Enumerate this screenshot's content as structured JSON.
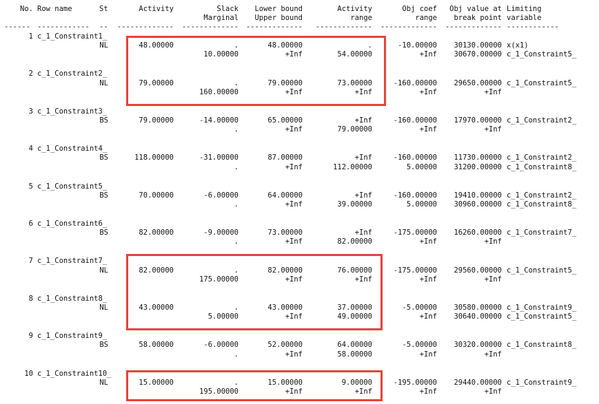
{
  "headers": {
    "no": "No.",
    "row_name": "Row name",
    "st": "St",
    "activity": "Activity",
    "slack_1": "Slack",
    "slack_2": "Marginal",
    "bound_1": "Lower bound",
    "bound_2": "Upper bound",
    "range_1": "Activity",
    "range_2": "range",
    "objcoef_1": "Obj coef",
    "objcoef_2": "range",
    "objval_1": "Obj value at",
    "objval_2": "break point",
    "limiting_1": "Limiting",
    "limiting_2": "variable"
  },
  "separator": {
    "no": "------",
    "row_name": "------------",
    "st": "--",
    "activity": "-------------",
    "slack": "-------------",
    "bound": "-------------",
    "range": "-------------",
    "objcoef": "-------------",
    "objval": "-------------",
    "limiting": "------------"
  },
  "rows": [
    {
      "no": "1",
      "name": "c_1_Constraint1_",
      "st": "NL",
      "activity": "48.00000",
      "slack": ".",
      "marginal": "10.00000",
      "lower": "48.00000",
      "upper": "+Inf",
      "range_lo": ".",
      "range_hi": "54.00000",
      "coef_lo": "-10.00000",
      "coef_hi": "+Inf",
      "objval_lo": "30130.00000",
      "objval_hi": "30670.00000",
      "limit_lo": "x(x1)",
      "limit_hi": "c_1_Constraint5_"
    },
    {
      "no": "2",
      "name": "c_1_Constraint2_",
      "st": "NL",
      "activity": "79.00000",
      "slack": ".",
      "marginal": "160.00000",
      "lower": "79.00000",
      "upper": "+Inf",
      "range_lo": "73.00000",
      "range_hi": "+Inf",
      "coef_lo": "-160.00000",
      "coef_hi": "+Inf",
      "objval_lo": "29650.00000",
      "objval_hi": "+Inf",
      "limit_lo": "c_1_Constraint5_",
      "limit_hi": ""
    },
    {
      "no": "3",
      "name": "c_1_Constraint3_",
      "st": "BS",
      "activity": "79.00000",
      "slack": "-14.00000",
      "marginal": ".",
      "lower": "65.00000",
      "upper": "+Inf",
      "range_lo": "+Inf",
      "range_hi": "79.00000",
      "coef_lo": "-160.00000",
      "coef_hi": "+Inf",
      "objval_lo": "17970.00000",
      "objval_hi": "+Inf",
      "limit_lo": "c_1_Constraint2_",
      "limit_hi": ""
    },
    {
      "no": "4",
      "name": "c_1_Constraint4_",
      "st": "BS",
      "activity": "118.00000",
      "slack": "-31.00000",
      "marginal": ".",
      "lower": "87.00000",
      "upper": "+Inf",
      "range_lo": "+Inf",
      "range_hi": "112.00000",
      "coef_lo": "-160.00000",
      "coef_hi": "5.00000",
      "objval_lo": "11730.00000",
      "objval_hi": "31200.00000",
      "limit_lo": "c_1_Constraint2_",
      "limit_hi": "c_1_Constraint8_"
    },
    {
      "no": "5",
      "name": "c_1_Constraint5_",
      "st": "BS",
      "activity": "70.00000",
      "slack": "-6.00000",
      "marginal": ".",
      "lower": "64.00000",
      "upper": "+Inf",
      "range_lo": "+Inf",
      "range_hi": "39.00000",
      "coef_lo": "-160.00000",
      "coef_hi": "5.00000",
      "objval_lo": "19410.00000",
      "objval_hi": "30960.00000",
      "limit_lo": "c_1_Constraint2_",
      "limit_hi": "c_1_Constraint8_"
    },
    {
      "no": "6",
      "name": "c_1_Constraint6_",
      "st": "BS",
      "activity": "82.00000",
      "slack": "-9.00000",
      "marginal": ".",
      "lower": "73.00000",
      "upper": "+Inf",
      "range_lo": "+Inf",
      "range_hi": "82.00000",
      "coef_lo": "-175.00000",
      "coef_hi": "+Inf",
      "objval_lo": "16260.00000",
      "objval_hi": "+Inf",
      "limit_lo": "c_1_Constraint7_",
      "limit_hi": ""
    },
    {
      "no": "7",
      "name": "c_1_Constraint7_",
      "st": "NL",
      "activity": "82.00000",
      "slack": ".",
      "marginal": "175.00000",
      "lower": "82.00000",
      "upper": "+Inf",
      "range_lo": "76.00000",
      "range_hi": "+Inf",
      "coef_lo": "-175.00000",
      "coef_hi": "+Inf",
      "objval_lo": "29560.00000",
      "objval_hi": "+Inf",
      "limit_lo": "c_1_Constraint5_",
      "limit_hi": ""
    },
    {
      "no": "8",
      "name": "c_1_Constraint8_",
      "st": "NL",
      "activity": "43.00000",
      "slack": ".",
      "marginal": "5.00000",
      "lower": "43.00000",
      "upper": "+Inf",
      "range_lo": "37.00000",
      "range_hi": "49.00000",
      "coef_lo": "-5.00000",
      "coef_hi": "+Inf",
      "objval_lo": "30580.00000",
      "objval_hi": "30640.00000",
      "limit_lo": "c_1_Constraint9_",
      "limit_hi": "c_1_Constraint5_"
    },
    {
      "no": "9",
      "name": "c_1_Constraint9_",
      "st": "BS",
      "activity": "58.00000",
      "slack": "-6.00000",
      "marginal": ".",
      "lower": "52.00000",
      "upper": "+Inf",
      "range_lo": "64.00000",
      "range_hi": "58.00000",
      "coef_lo": "-5.00000",
      "coef_hi": "+Inf",
      "objval_lo": "30320.00000",
      "objval_hi": "+Inf",
      "limit_lo": "c_1_Constraint8_",
      "limit_hi": ""
    },
    {
      "no": "10",
      "name": "c_1_Constraint10_",
      "st": "NL",
      "activity": "15.00000",
      "slack": ".",
      "marginal": "195.00000",
      "lower": "15.00000",
      "upper": "+Inf",
      "range_lo": "9.00000",
      "range_hi": "+Inf",
      "coef_lo": "-195.00000",
      "coef_hi": "+Inf",
      "objval_lo": "29440.00000",
      "objval_hi": "+Inf",
      "limit_lo": "c_1_Constraint9_",
      "limit_hi": ""
    }
  ],
  "highlight_color": "#e8423a"
}
